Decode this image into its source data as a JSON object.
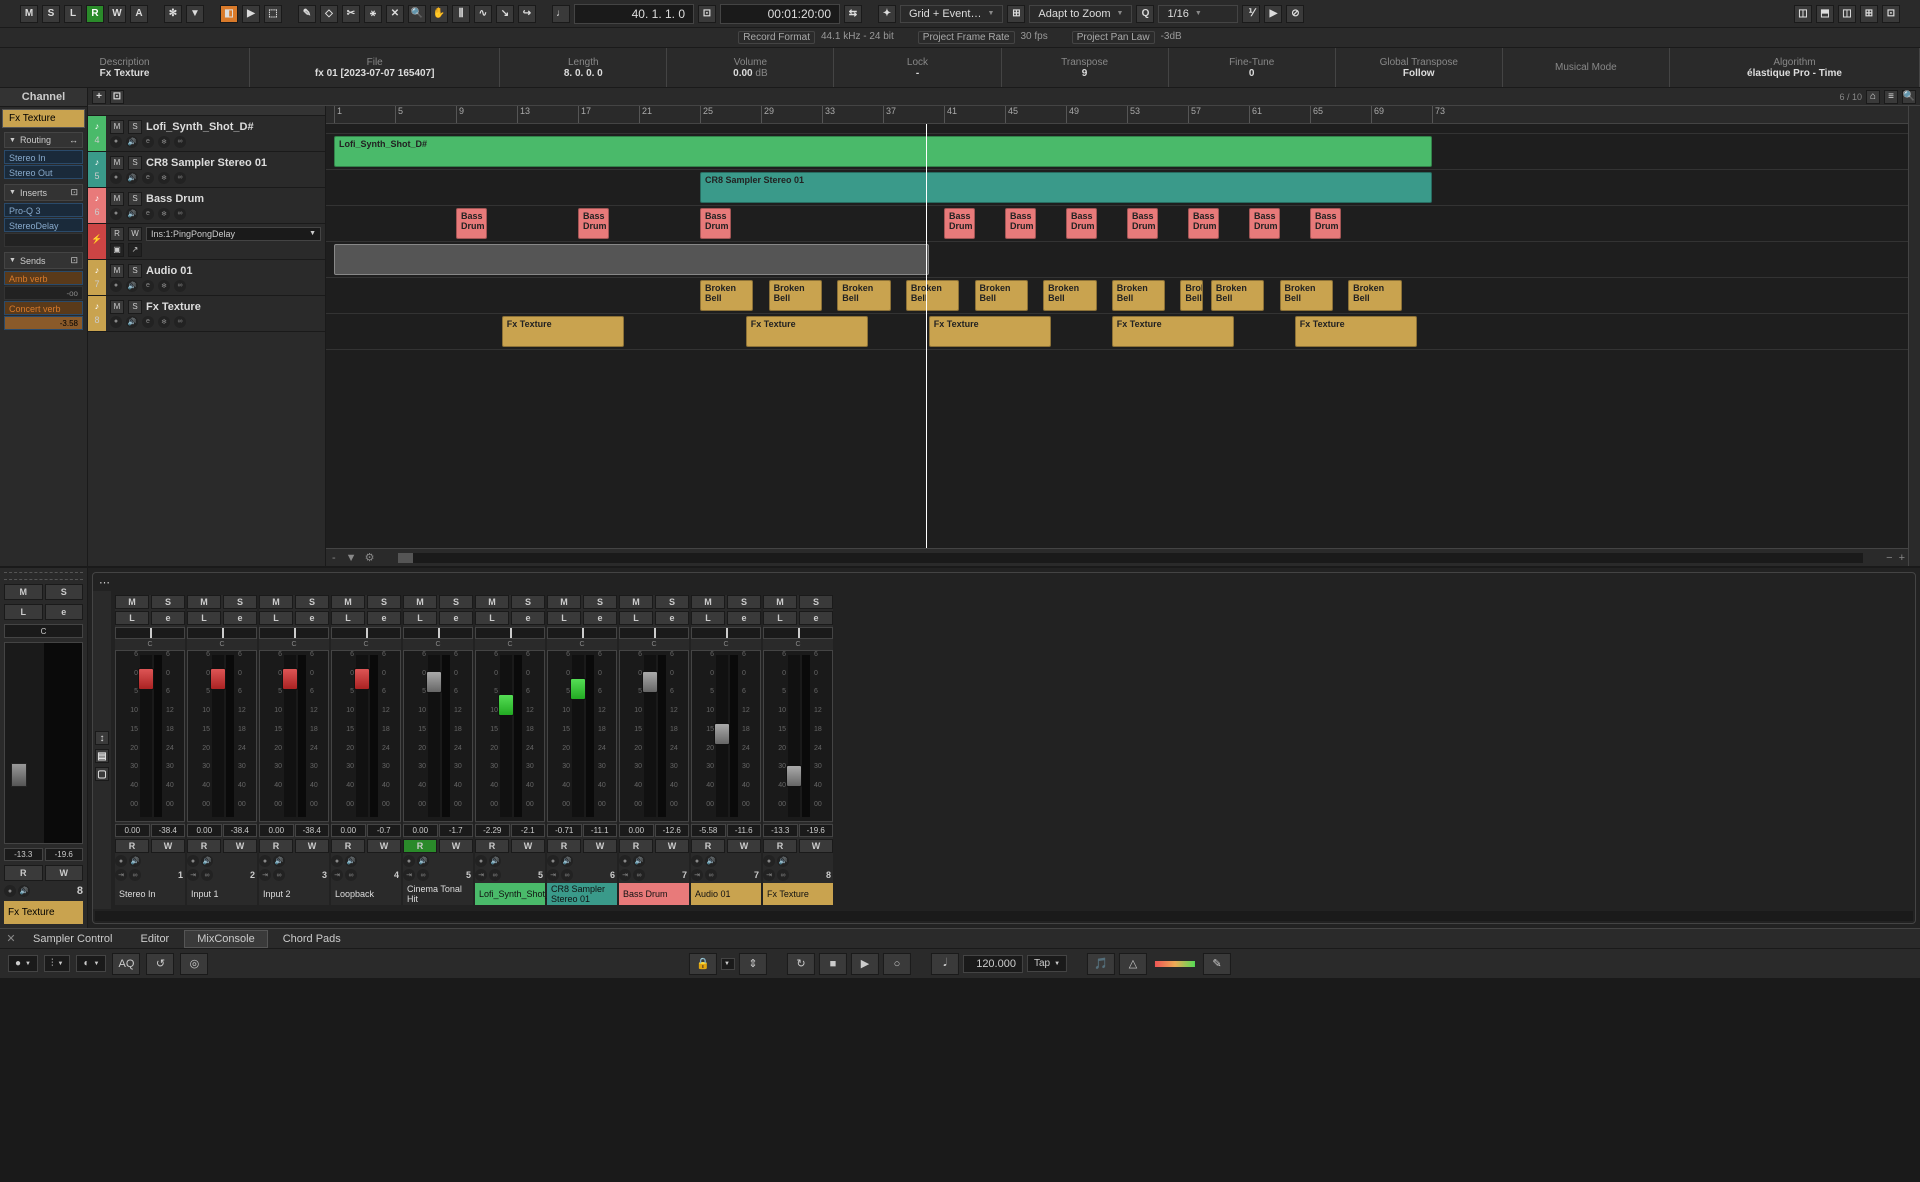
{
  "toolbar": {
    "m": "M",
    "s": "S",
    "l": "L",
    "r": "R",
    "w": "W",
    "a": "A",
    "position": "40.  1.  1.     0",
    "timecode": "00:01:20:00",
    "snap_mode": "Grid + Event…",
    "auto_scroll": "Adapt to Zoom",
    "quantize": "1/16"
  },
  "info_strip": {
    "rec_fmt_label": "Record Format",
    "rec_fmt": "44.1 kHz - 24 bit",
    "fps_label": "Project Frame Rate",
    "fps": "30 fps",
    "pan_label": "Project Pan Law",
    "pan": "-3dB"
  },
  "project_info": {
    "desc_label": "Description",
    "desc_value": "Fx Texture",
    "file_label": "File",
    "file_value": "fx 01 [2023-07-07 165407]",
    "len_label": "Length",
    "len_value": "8.  0.  0.    0",
    "vol_label": "Volume",
    "vol_value": "0.00",
    "vol_unit": "dB",
    "lock_label": "Lock",
    "lock_value": "-",
    "trans_label": "Transpose",
    "trans_value": "9",
    "fine_label": "Fine-Tune",
    "fine_value": "0",
    "global_label": "Global Transpose",
    "global_value": "Follow",
    "mode_label": "Musical Mode",
    "mode_value": "",
    "algo_label": "Algorithm",
    "algo_value": "élastique Pro - Time"
  },
  "channel_panel": {
    "header": "Channel",
    "selected": "Fx Texture",
    "routing_label": "Routing",
    "routing_in": "Stereo In",
    "routing_out": "Stereo Out",
    "inserts_label": "Inserts",
    "inserts": [
      "Pro-Q 3",
      "StereoDelay"
    ],
    "sends_label": "Sends",
    "sends": [
      {
        "name": "Amb verb",
        "val": "-oo"
      },
      {
        "name": "Concert verb",
        "val": "-3.58"
      }
    ],
    "mini_ms": {
      "m": "M",
      "s": "S",
      "l": "L",
      "e": "e"
    },
    "mini_pan": "C",
    "mini_vals": [
      "-13.3",
      "-19.6"
    ],
    "mini_rw": {
      "r": "R",
      "w": "W"
    },
    "mini_num": "8",
    "mini_label": "Fx Texture"
  },
  "track_bar": {
    "count": "6 / 10"
  },
  "tracks": [
    {
      "num": "4",
      "color": "#4aba6a",
      "name": "Lofi_Synth_Shot_D#"
    },
    {
      "num": "5",
      "color": "#3a9a8a",
      "name": "CR8 Sampler Stereo 01"
    },
    {
      "num": "6",
      "color": "#e87a7a",
      "name": "Bass Drum"
    },
    {
      "num": "",
      "color": "#c44",
      "name": "Ins:1:PingPongDelay",
      "fx": true
    },
    {
      "num": "7",
      "color": "#c9a34f",
      "name": "Audio 01"
    },
    {
      "num": "8",
      "color": "#c9a34f",
      "name": "Fx Texture"
    }
  ],
  "ruler_ticks": [
    "1",
    "5",
    "9",
    "13",
    "17",
    "21",
    "25",
    "29",
    "33",
    "37",
    "41",
    "45",
    "49",
    "53",
    "57",
    "61",
    "65",
    "69",
    "73"
  ],
  "clips": {
    "lofi": "Lofi_Synth_Shot_D#",
    "cr8": "CR8 Sampler Stereo 01",
    "bass": "Bass Drum",
    "bell": "Broken Bell",
    "fx": "Fx Texture"
  },
  "mixer": {
    "strips": [
      {
        "num": "1",
        "name": "Stereo In",
        "color": "",
        "fader": "red",
        "pos": 8,
        "v1": "0.00",
        "v2": "-38.4",
        "r_on": false
      },
      {
        "num": "2",
        "name": "Input 1",
        "color": "",
        "fader": "red",
        "pos": 8,
        "v1": "0.00",
        "v2": "-38.4",
        "r_on": false
      },
      {
        "num": "3",
        "name": "Input 2",
        "color": "",
        "fader": "red",
        "pos": 8,
        "v1": "0.00",
        "v2": "-38.4",
        "r_on": false
      },
      {
        "num": "4",
        "name": "Loopback",
        "color": "",
        "fader": "red",
        "pos": 8,
        "v1": "0.00",
        "v2": "-0.7",
        "r_on": false
      },
      {
        "num": "5",
        "name": "Cinema Tonal Hit",
        "color": "",
        "fader": "grey",
        "pos": 10,
        "v1": "0.00",
        "v2": "-1.7",
        "r_on": true
      },
      {
        "num": "5",
        "name": "Lofi_Synth_Shot_D#",
        "color": "green",
        "fader": "green",
        "pos": 24,
        "v1": "-2.29",
        "v2": "-2.1",
        "r_on": false
      },
      {
        "num": "6",
        "name": "CR8 Sampler Stereo 01",
        "color": "teal",
        "fader": "green",
        "pos": 14,
        "v1": "-0.71",
        "v2": "-11.1",
        "r_on": false
      },
      {
        "num": "7",
        "name": "Bass Drum",
        "color": "salmon",
        "fader": "grey",
        "pos": 10,
        "v1": "0.00",
        "v2": "-12.6",
        "r_on": false
      },
      {
        "num": "7",
        "name": "Audio 01",
        "color": "tan",
        "fader": "grey",
        "pos": 42,
        "v1": "-5.58",
        "v2": "-11.6",
        "r_on": false
      },
      {
        "num": "8",
        "name": "Fx Texture",
        "color": "tan",
        "fader": "grey",
        "pos": 68,
        "v1": "-13.3",
        "v2": "-19.6",
        "r_on": false
      }
    ],
    "btn_m": "M",
    "btn_s": "S",
    "btn_l": "L",
    "btn_e": "e",
    "btn_r": "R",
    "btn_w": "W",
    "pan_c": "C",
    "scale": [
      "6",
      "0",
      "5",
      "10",
      "15",
      "20",
      "30",
      "40",
      "00"
    ],
    "meter_scale": [
      "6",
      "0",
      "6",
      "12",
      "18",
      "24",
      "30",
      "40",
      "00"
    ]
  },
  "lower_tabs": {
    "t1": "Sampler Control",
    "t2": "Editor",
    "t3": "MixConsole",
    "t4": "Chord Pads"
  },
  "transport": {
    "tempo": "120.000",
    "tap": "Tap",
    "aq": "AQ"
  }
}
